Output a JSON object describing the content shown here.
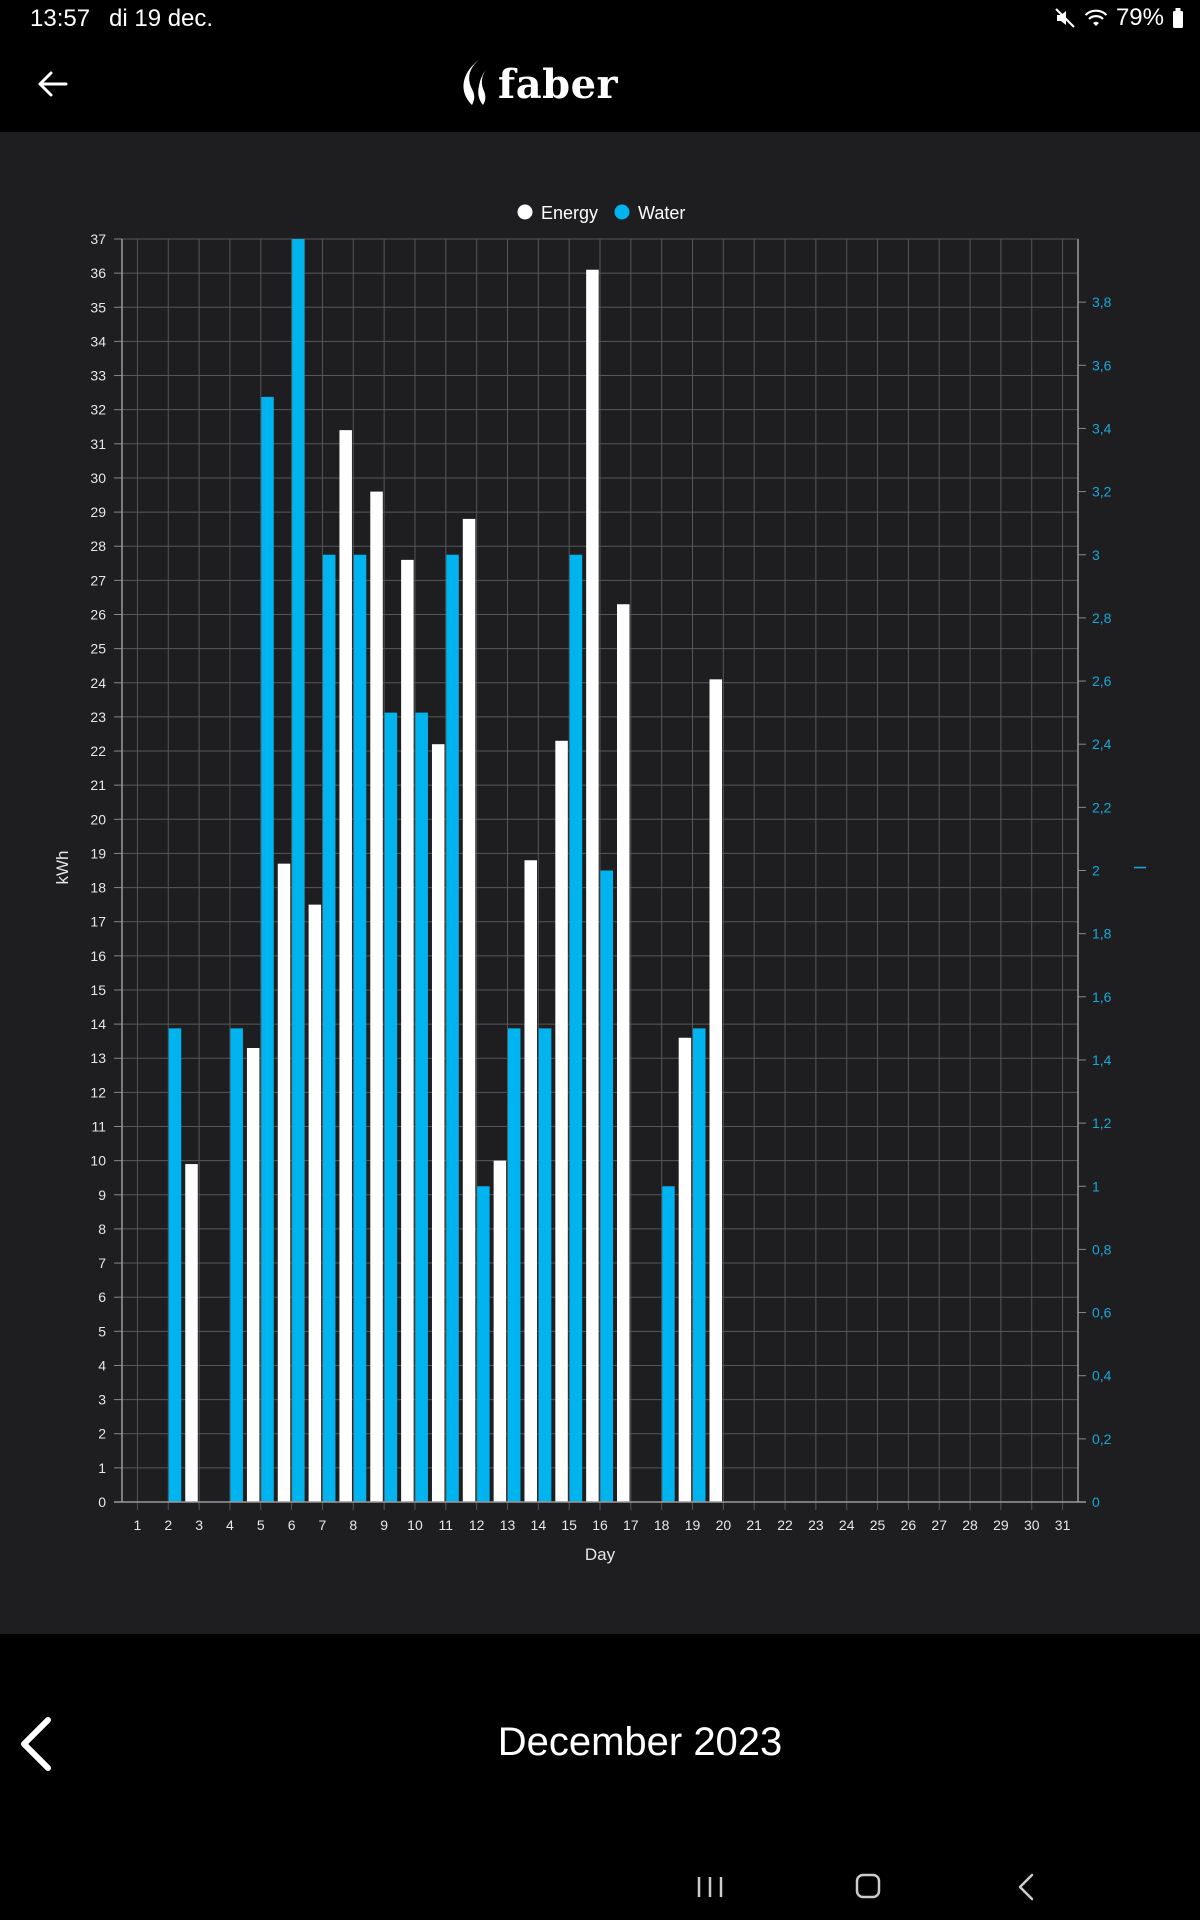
{
  "status": {
    "time": "13:57",
    "date": "di 19 dec.",
    "battery": "79%",
    "icons": [
      "mute-icon",
      "wifi-icon",
      "battery-icon"
    ]
  },
  "header": {
    "back_icon": "arrow-left-icon",
    "logo_text": "faber",
    "logo_icon": "flame-icon"
  },
  "chart_data": {
    "type": "bar",
    "legend": [
      "Energy",
      "Water"
    ],
    "legend_position": "top-center",
    "xlabel": "Day",
    "ylabel_left": "kWh",
    "ylabel_right": "l",
    "x": [
      1,
      2,
      3,
      4,
      5,
      6,
      7,
      8,
      9,
      10,
      11,
      12,
      13,
      14,
      15,
      16,
      17,
      18,
      19,
      20,
      21,
      22,
      23,
      24,
      25,
      26,
      27,
      28,
      29,
      30,
      31
    ],
    "ylim_left": [
      0,
      37
    ],
    "ylim_right": [
      0,
      4
    ],
    "grid": true,
    "colors": {
      "Energy": "#ffffff",
      "Water": "#00b4ef",
      "right_axis": "#1aa7d9"
    },
    "right_ticks": [
      "0",
      "0,2",
      "0,4",
      "0,6",
      "0,8",
      "1",
      "1,2",
      "1,4",
      "1,6",
      "1,8",
      "2",
      "2,2",
      "2,4",
      "2,6",
      "2,8",
      "3",
      "3,2",
      "3,4",
      "3,6",
      "3,8"
    ],
    "series": [
      {
        "name": "Energy",
        "axis": "left",
        "values": [
          0,
          9.9,
          0,
          13.3,
          18.7,
          17.5,
          31.4,
          29.6,
          27.6,
          22.2,
          28.8,
          10.0,
          18.8,
          22.3,
          36.1,
          26.3,
          0,
          13.6,
          24.1,
          0,
          0,
          0,
          0,
          0,
          0,
          0,
          0,
          0,
          0,
          0,
          0
        ]
      },
      {
        "name": "Water",
        "axis": "right",
        "values": [
          0,
          1.5,
          0,
          1.5,
          3.5,
          4.0,
          3.0,
          3.0,
          2.5,
          2.5,
          3.0,
          1.0,
          1.5,
          1.5,
          3.0,
          2.0,
          0,
          1.0,
          1.5,
          0,
          0,
          0,
          0,
          0,
          0,
          0,
          0,
          0,
          0,
          0,
          0
        ]
      }
    ]
  },
  "month_nav": {
    "prev_icon": "chevron-left-icon",
    "label": "December 2023"
  },
  "system_nav": {
    "icons": [
      "recents-icon",
      "home-icon",
      "back-icon"
    ]
  }
}
